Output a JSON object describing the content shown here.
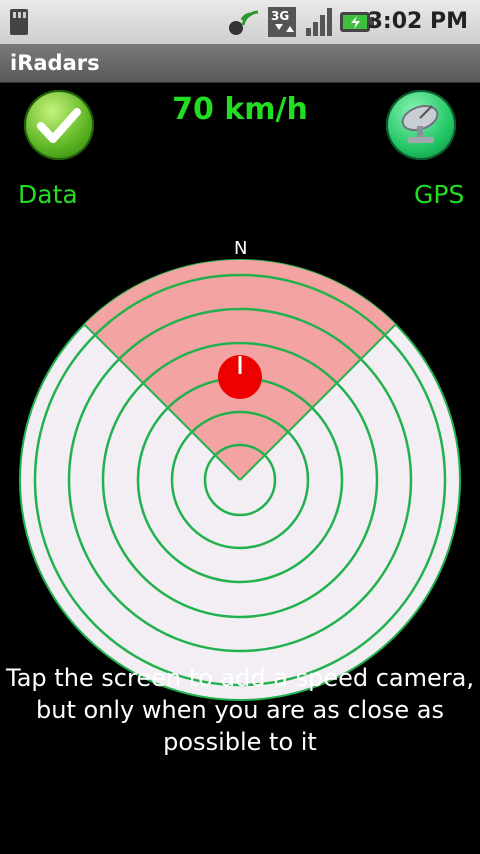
{
  "status_bar": {
    "time": "3:02 PM",
    "network": "3G",
    "icons": [
      "sd-card-icon",
      "wireless-sync-icon",
      "network-3g-icon",
      "signal-icon",
      "battery-charging-icon"
    ]
  },
  "app": {
    "title": "iRadars"
  },
  "speed": {
    "text": "70 km/h"
  },
  "buttons": {
    "data": {
      "label": "Data",
      "icon": "check-icon"
    },
    "gps": {
      "label": "GPS",
      "icon": "satellite-dish-icon"
    }
  },
  "radar": {
    "north_label": "N",
    "rings": 6,
    "colors": {
      "disk": "#f2eef4",
      "sector": "#f4a3a3",
      "rings": "#22b14c",
      "camera": "#ee0000"
    }
  },
  "hint": {
    "lines": [
      "Tap the screen to add a speed camera,",
      "but only when you are as close as",
      "possible to it"
    ]
  }
}
